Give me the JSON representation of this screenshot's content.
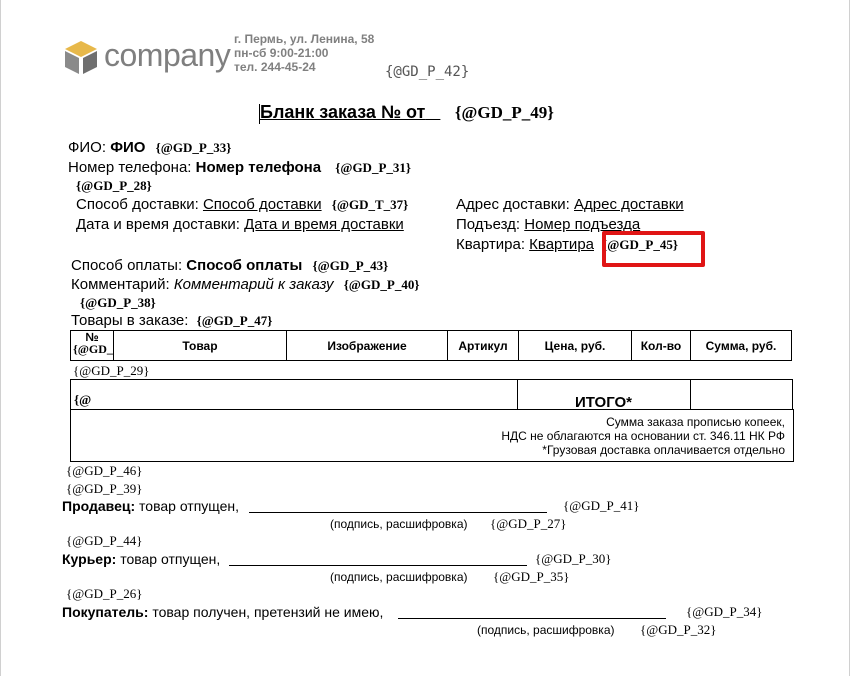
{
  "header": {
    "logo_text": "company",
    "address": "г. Пермь, ул. Ленина, 58",
    "hours": "пн-сб 9:00-21:00",
    "phone": "тел. 244-45-24",
    "tag_top": "{@GD_P_42}"
  },
  "title": {
    "text": "Бланк заказа № от",
    "tag": "{@GD_P_49}"
  },
  "fields": {
    "fio_label": "ФИО:",
    "fio_value": "ФИО",
    "fio_tag": "{@GD_P_33}",
    "phone_label": "Номер телефона:",
    "phone_value": "Номер телефона",
    "phone_tag": "{@GD_P_31}",
    "tag_28": "{@GD_P_28}",
    "delivery_method_label": "Способ доставки:",
    "delivery_method_value": "Способ доставки",
    "delivery_method_tag": "{@GD_T_37}",
    "delivery_datetime_label": "Дата и время доставки:",
    "delivery_datetime_value": "Дата и время доставки",
    "address_label": "Адрес доставки:",
    "address_value": "Адрес доставки",
    "entrance_label": "Подъезд:",
    "entrance_value": "Номер подъезда",
    "apartment_label": "Квартира:",
    "apartment_value": "Квартира",
    "apartment_tag": "{@GD_P_45}",
    "payment_label": "Способ оплаты:",
    "payment_value": "Способ оплаты",
    "payment_tag": "{@GD_P_43}",
    "comment_label": "Комментарий:",
    "comment_value": "Комментарий к заказу",
    "comment_tag": "{@GD_P_40}",
    "tag_38": "{@GD_P_38}",
    "goods_label": "Товары в заказе:",
    "goods_tag": "{@GD_P_47}"
  },
  "table": {
    "headers": [
      "№",
      "Товар",
      "Изображение",
      "Артикул",
      "Цена, руб.",
      "Кол-во",
      "Сумма, руб."
    ],
    "num_cell_tag": "{@GD_",
    "tag_29": "{@GD_P_29}",
    "total_cell_tag": "{@",
    "total_label": "ИТОГО*",
    "sum_words": "Сумма заказа прописью  копеек,",
    "vat_note": "НДС не облагаются на основании ст. 346.11 НК РФ",
    "cargo_note": "*Грузовая доставка оплачивается отдельно"
  },
  "signatures": {
    "tag_46": "{@GD_P_46}",
    "tag_39": "{@GD_P_39}",
    "seller_label": "Продавец:",
    "seller_text": "товар отпущен,",
    "seller_tag": "{@GD_P_41}",
    "seller_sub": "(подпись, расшифровка)",
    "seller_sub_tag": "{@GD_P_27}",
    "tag_44": "{@GD_P_44}",
    "courier_label": "Курьер:",
    "courier_text": "товар отпущен,",
    "courier_tag": "{@GD_P_30}",
    "courier_sub": "(подпись, расшифровка)",
    "courier_sub_tag": "{@GD_P_35}",
    "tag_26": "{@GD_P_26}",
    "buyer_label": "Покупатель:",
    "buyer_text": "товар получен, претензий не имею,",
    "buyer_tag": "{@GD_P_34}",
    "buyer_sub": "(подпись, расшифровка)",
    "buyer_sub_tag": "{@GD_P_32}"
  },
  "colors": {
    "highlight": "#e01515",
    "logo_gray": "#7f7f7f",
    "logo_gold": "#e7b84a"
  }
}
